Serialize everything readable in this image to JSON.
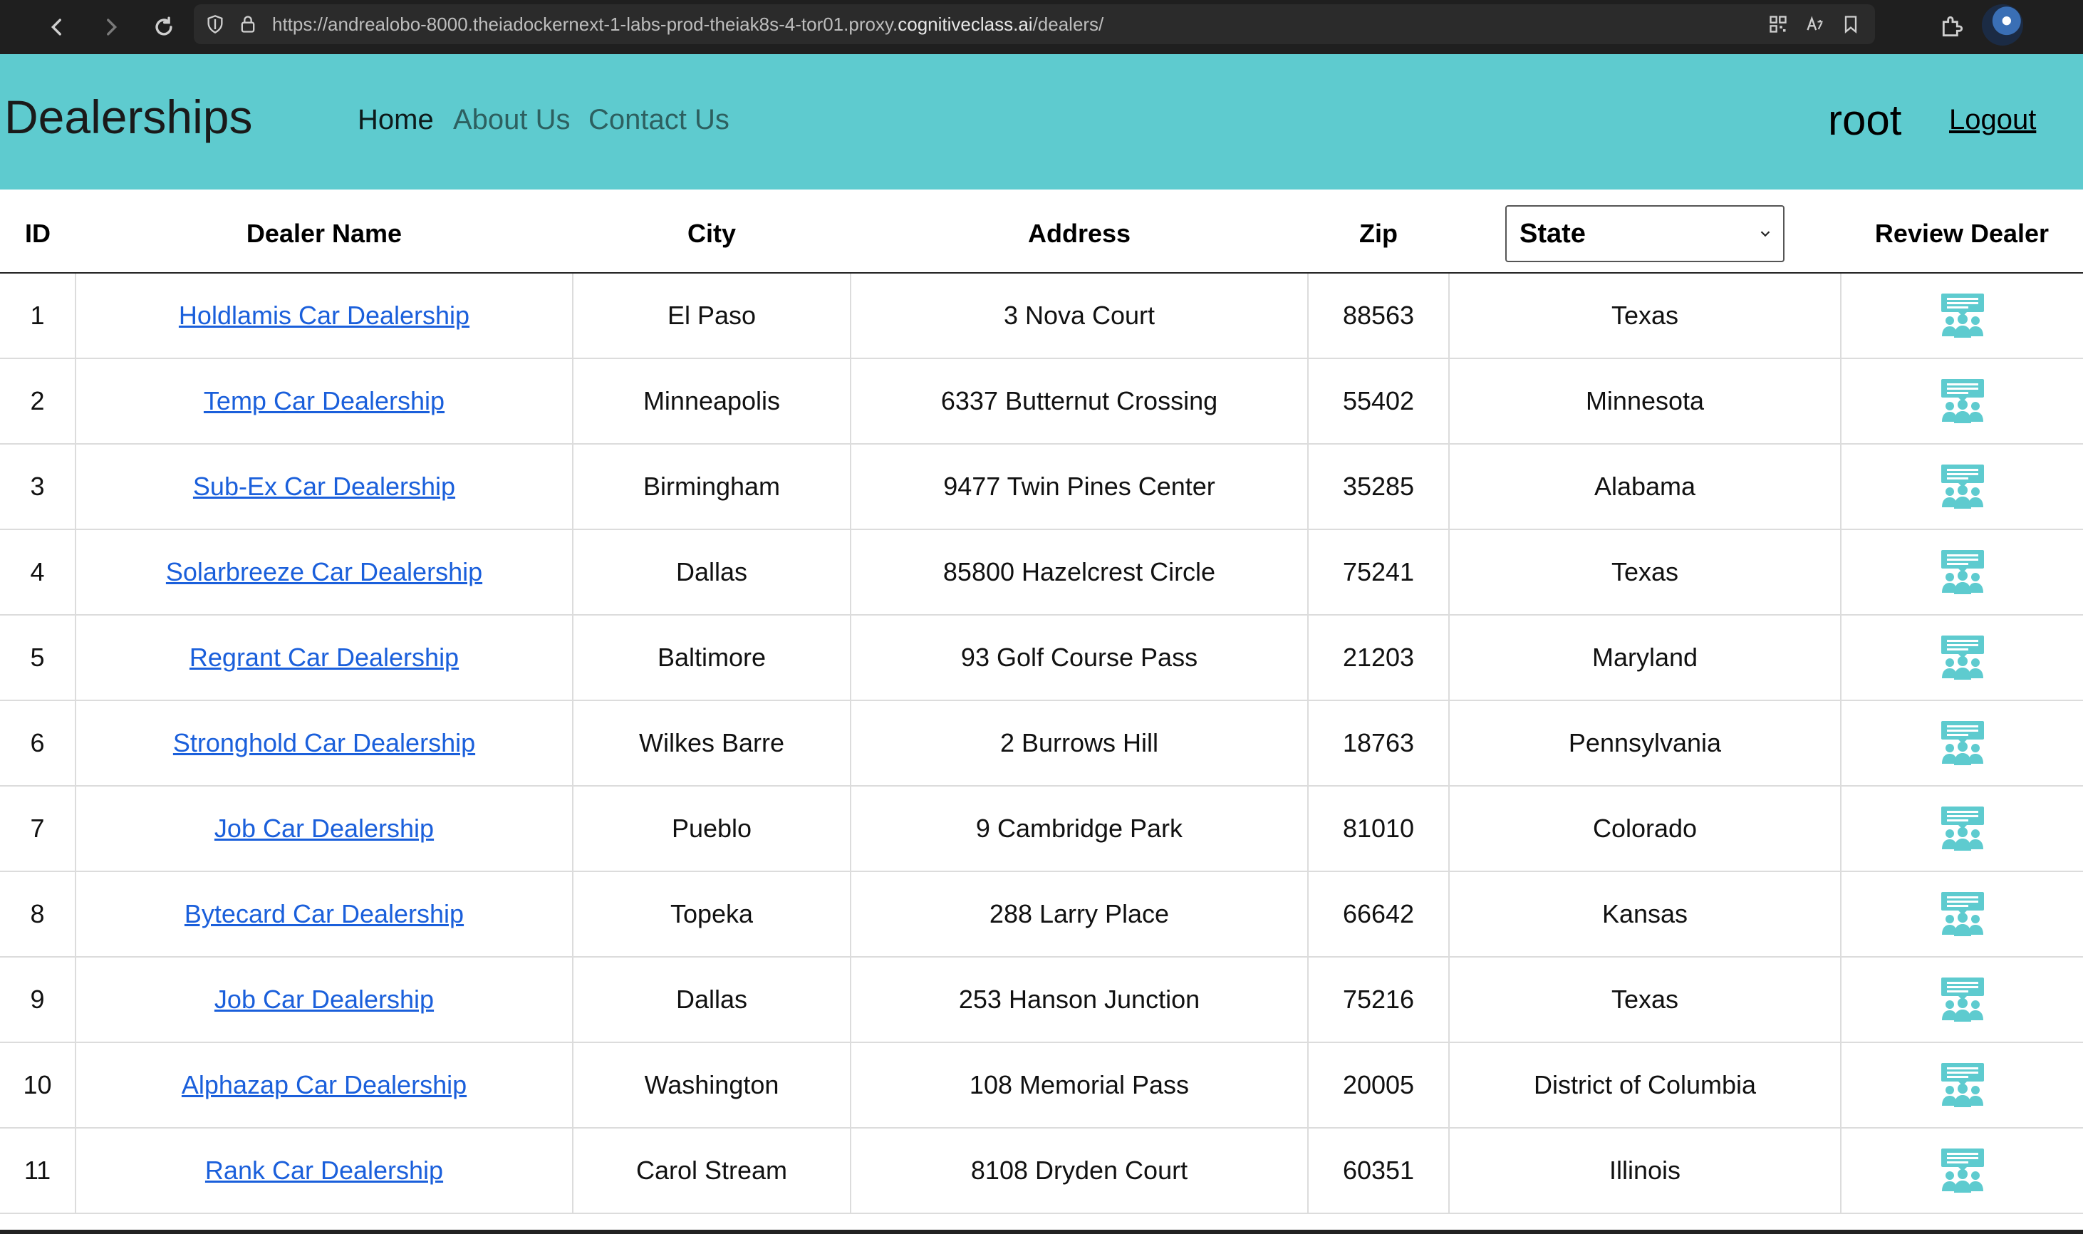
{
  "browser": {
    "url_prefix": "https://andrealobo-8000.theiadockernext-1-labs-prod-theiak8s-4-tor01.proxy.",
    "url_host": "cognitiveclass.ai",
    "url_path": "/dealers/"
  },
  "navbar": {
    "brand": "Dealerships",
    "links": [
      "Home",
      "About Us",
      "Contact Us"
    ],
    "username": "root",
    "logout": "Logout",
    "bg_color": "#5ecbcf"
  },
  "table": {
    "headers": {
      "id": "ID",
      "name": "Dealer Name",
      "city": "City",
      "address": "Address",
      "zip": "Zip",
      "state_select": "State",
      "review": "Review Dealer"
    },
    "rows": [
      {
        "id": "1",
        "name": "Holdlamis Car Dealership",
        "city": "El Paso",
        "address": "3 Nova Court",
        "zip": "88563",
        "state": "Texas"
      },
      {
        "id": "2",
        "name": "Temp Car Dealership",
        "city": "Minneapolis",
        "address": "6337 Butternut Crossing",
        "zip": "55402",
        "state": "Minnesota"
      },
      {
        "id": "3",
        "name": "Sub-Ex Car Dealership",
        "city": "Birmingham",
        "address": "9477 Twin Pines Center",
        "zip": "35285",
        "state": "Alabama"
      },
      {
        "id": "4",
        "name": "Solarbreeze Car Dealership",
        "city": "Dallas",
        "address": "85800 Hazelcrest Circle",
        "zip": "75241",
        "state": "Texas"
      },
      {
        "id": "5",
        "name": "Regrant Car Dealership",
        "city": "Baltimore",
        "address": "93 Golf Course Pass",
        "zip": "21203",
        "state": "Maryland"
      },
      {
        "id": "6",
        "name": "Stronghold Car Dealership",
        "city": "Wilkes Barre",
        "address": "2 Burrows Hill",
        "zip": "18763",
        "state": "Pennsylvania"
      },
      {
        "id": "7",
        "name": "Job Car Dealership",
        "city": "Pueblo",
        "address": "9 Cambridge Park",
        "zip": "81010",
        "state": "Colorado"
      },
      {
        "id": "8",
        "name": "Bytecard Car Dealership",
        "city": "Topeka",
        "address": "288 Larry Place",
        "zip": "66642",
        "state": "Kansas"
      },
      {
        "id": "9",
        "name": "Job Car Dealership",
        "city": "Dallas",
        "address": "253 Hanson Junction",
        "zip": "75216",
        "state": "Texas"
      },
      {
        "id": "10",
        "name": "Alphazap Car Dealership",
        "city": "Washington",
        "address": "108 Memorial Pass",
        "zip": "20005",
        "state": "District of Columbia"
      },
      {
        "id": "11",
        "name": "Rank Car Dealership",
        "city": "Carol Stream",
        "address": "8108 Dryden Court",
        "zip": "60351",
        "state": "Illinois"
      }
    ],
    "review_icon": "review-people-icon",
    "icon_color": "#5ecbcf",
    "link_color": "#1a5fdb"
  }
}
